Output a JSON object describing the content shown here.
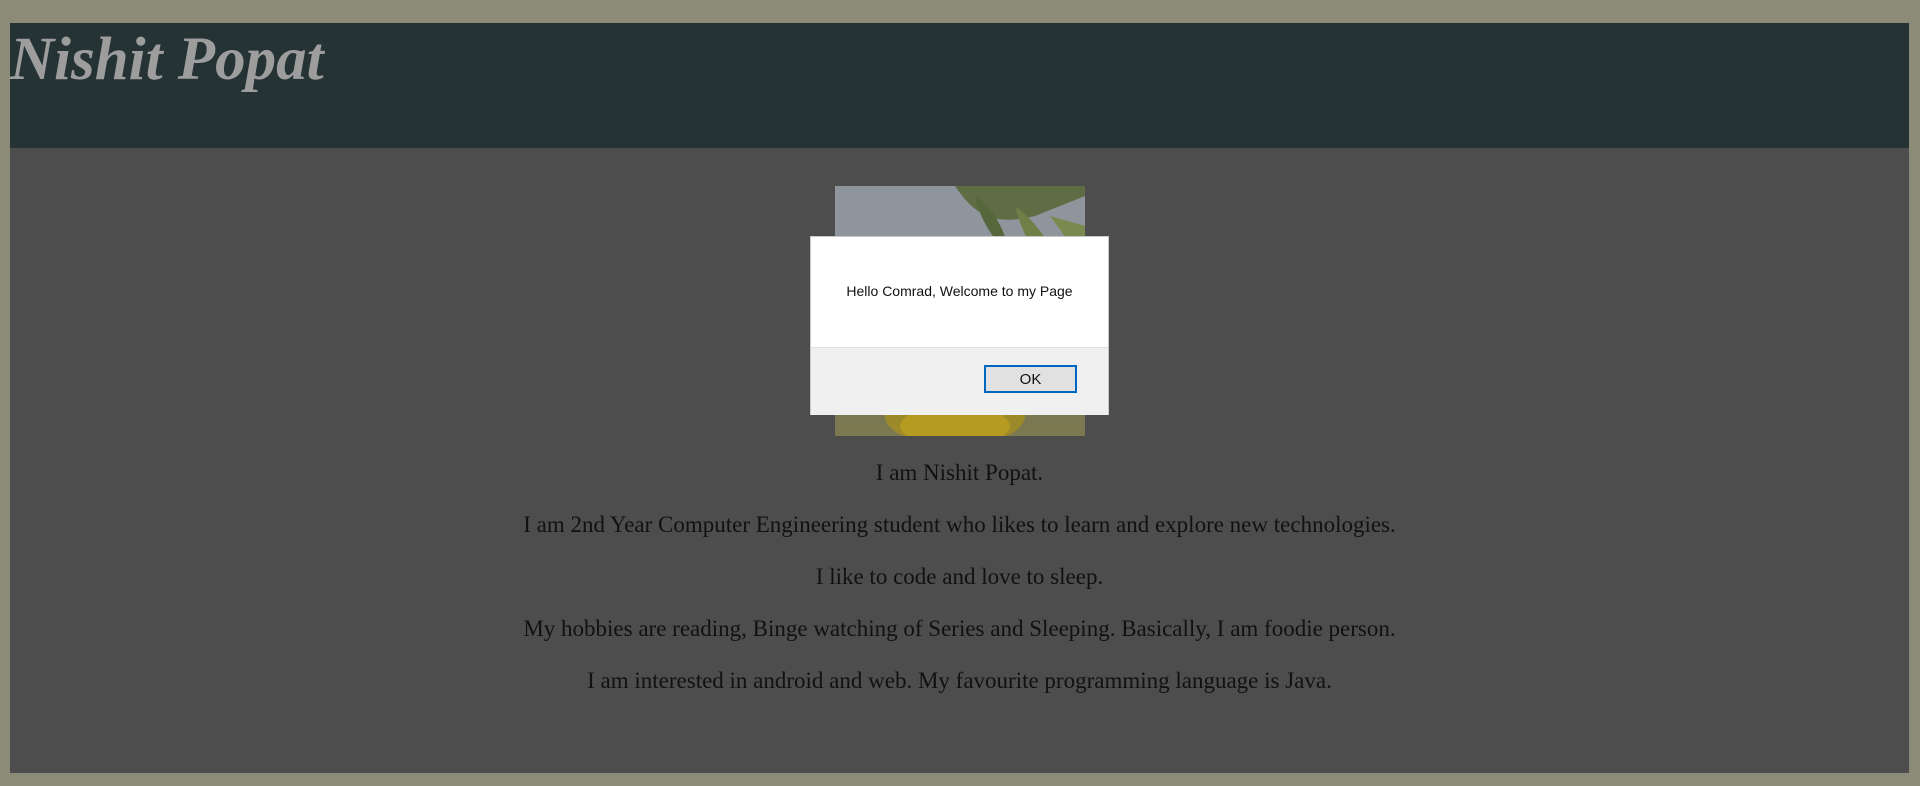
{
  "header": {
    "title": "Nishit Popat"
  },
  "bio": {
    "lines": [
      "I am Nishit Popat.",
      "I am 2nd Year Computer Engineering student who likes to learn and explore new technologies.",
      "I like to code and love to sleep.",
      "My hobbies are reading, Binge watching of Series and Sleeping. Basically, I am foodie person.",
      "I am interested in android and web. My favourite programming language is Java."
    ]
  },
  "alert": {
    "message": "Hello Comrad, Welcome to my Page",
    "ok_label": "OK"
  },
  "colors": {
    "outer_frame": "#8b8b78",
    "header_bg": "#253335",
    "page_bg": "#4d4d4d",
    "title_text": "#9d9d9d",
    "button_focus": "#0067c0"
  }
}
